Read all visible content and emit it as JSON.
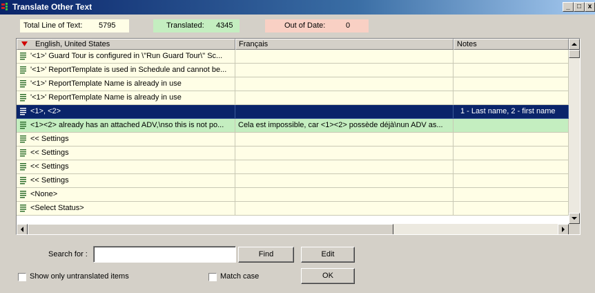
{
  "window": {
    "title": "Translate Other Text",
    "controls": {
      "minimize": "_",
      "maximize": "□",
      "close": "x"
    }
  },
  "stats": {
    "total_label": "Total Line of Text:",
    "total_value": "5795",
    "translated_label": "Translated:",
    "translated_value": "4345",
    "outofdate_label": "Out of Date:",
    "outofdate_value": "0",
    "colors": {
      "total_bg": "#fffee6",
      "translated_bg": "#c4eec0",
      "outofdate_bg": "#f9d0c4"
    }
  },
  "grid": {
    "sort_icon": "sort-descending-icon",
    "columns": [
      "English, United States",
      "Français",
      "Notes"
    ],
    "rows": [
      {
        "english": "'<1>' Guard Tour is configured in \\\"Run Guard Tour\\\" Sc...",
        "french": "",
        "notes": "",
        "state": "normal"
      },
      {
        "english": "'<1>' ReportTemplate is used in Schedule and cannot be...",
        "french": "",
        "notes": "",
        "state": "normal"
      },
      {
        "english": "'<1>' ReportTemplate Name is already in use",
        "french": "",
        "notes": "",
        "state": "normal"
      },
      {
        "english": "'<1>' ReportTemplate Name is already in use",
        "french": "",
        "notes": "",
        "state": "normal"
      },
      {
        "english": "<1>, <2>",
        "french": "",
        "notes": "1 - Last name, 2 - first name",
        "state": "selected"
      },
      {
        "english": "<1><2> already has an attached ADV,\\nso this is not po...",
        "french": "Cela est impossible, car <1><2> possède déjà\\nun ADV as...",
        "notes": "",
        "state": "translated"
      },
      {
        "english": "<< Settings",
        "french": "",
        "notes": "",
        "state": "normal"
      },
      {
        "english": "<< Settings",
        "french": "",
        "notes": "",
        "state": "normal"
      },
      {
        "english": "<< Settings",
        "french": "",
        "notes": "",
        "state": "normal"
      },
      {
        "english": "<< Settings",
        "french": "",
        "notes": "",
        "state": "normal"
      },
      {
        "english": "<None>",
        "french": "",
        "notes": "",
        "state": "normal"
      },
      {
        "english": "<Select Status>",
        "french": "",
        "notes": "",
        "state": "normal"
      }
    ]
  },
  "search": {
    "label": "Search for :",
    "value": "",
    "find_label": "Find",
    "edit_label": "Edit",
    "ok_label": "OK"
  },
  "options": {
    "untranslated_label": "Show only untranslated items",
    "untranslated_checked": false,
    "matchcase_label": "Match case",
    "matchcase_checked": false
  }
}
